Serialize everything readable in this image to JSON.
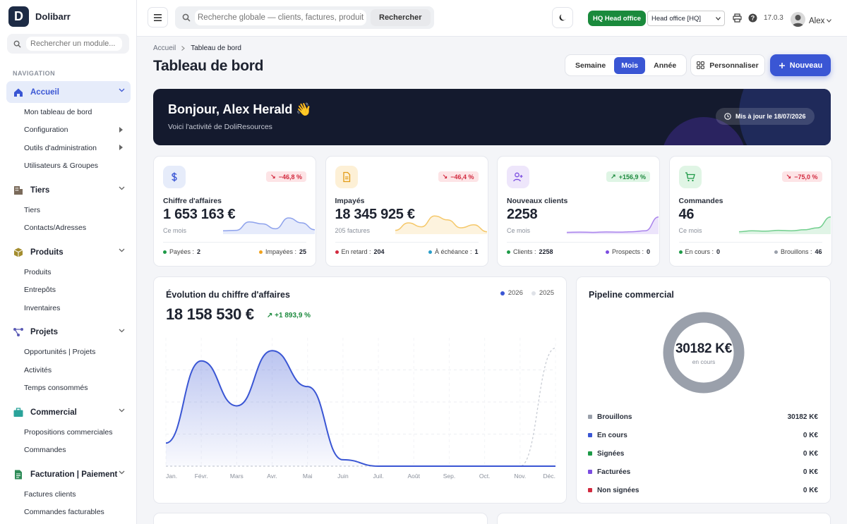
{
  "brand": {
    "logo_letter": "D",
    "name": "Dolibarr"
  },
  "sidebar": {
    "search_placeholder": "Rechercher un module...",
    "nav_label": "NAVIGATION",
    "sections": [
      {
        "label": "Accueil",
        "icon": "home-icon",
        "active": true,
        "items": [
          {
            "label": "Mon tableau de bord",
            "sub": false
          },
          {
            "label": "Configuration",
            "sub": true
          },
          {
            "label": "Outils d'administration",
            "sub": true
          },
          {
            "label": "Utilisateurs & Groupes",
            "sub": false
          }
        ]
      },
      {
        "label": "Tiers",
        "icon": "building-icon",
        "items": [
          {
            "label": "Tiers"
          },
          {
            "label": "Contacts/Adresses"
          }
        ]
      },
      {
        "label": "Produits",
        "icon": "box-icon",
        "items": [
          {
            "label": "Produits"
          },
          {
            "label": "Entrepôts"
          },
          {
            "label": "Inventaires"
          }
        ]
      },
      {
        "label": "Projets",
        "icon": "project-icon",
        "items": [
          {
            "label": "Opportunités | Projets"
          },
          {
            "label": "Activités"
          },
          {
            "label": "Temps consommés"
          }
        ]
      },
      {
        "label": "Commercial",
        "icon": "briefcase-icon",
        "items": [
          {
            "label": "Propositions commerciales"
          },
          {
            "label": "Commandes"
          }
        ]
      },
      {
        "label": "Facturation | Paiement",
        "icon": "invoice-icon",
        "items": [
          {
            "label": "Factures clients"
          },
          {
            "label": "Commandes facturables"
          }
        ]
      }
    ]
  },
  "topbar": {
    "search_placeholder": "Recherche globale — clients, factures, produits...",
    "search_button": "Rechercher",
    "hq_badge": "HQ Head office",
    "entity": "Head office [HQ]",
    "version": "17.0.3",
    "user": "Alex"
  },
  "page": {
    "breadcrumb": [
      "Accueil",
      "Tableau de bord"
    ],
    "title": "Tableau de bord",
    "periods": [
      "Semaine",
      "Mois",
      "Année"
    ],
    "active_period": "Mois",
    "customize": "Personnaliser",
    "new": "Nouveau"
  },
  "banner": {
    "greeting": "Bonjour, Alex Herald 👋",
    "subtitle": "Voici l'activité de DoliResources",
    "updated": "Mis à jour le 18/07/2026"
  },
  "kpis": [
    {
      "label": "Chiffre d'affaires",
      "value": "1 653 163 €",
      "sub": "Ce mois",
      "delta": "−46,8 %",
      "trend": "down",
      "icon": "dollar-icon",
      "icon_bg": "#e6ecfa",
      "icon_color": "#3a56d4",
      "spark_color": "#8ea2ec",
      "foot": [
        {
          "label": "Payées :",
          "value": "2",
          "color": "#1d9a47"
        },
        {
          "label": "Impayées :",
          "value": "25",
          "color": "#f0a21d"
        }
      ]
    },
    {
      "label": "Impayés",
      "value": "18 345 925 €",
      "sub": "205 factures",
      "delta": "−46,4 %",
      "trend": "down",
      "icon": "file-icon",
      "icon_bg": "#fdf0d6",
      "icon_color": "#e29a14",
      "spark_color": "#f5c86a",
      "foot": [
        {
          "label": "En retard :",
          "value": "204",
          "color": "#d22a3f"
        },
        {
          "label": "À échéance :",
          "value": "1",
          "color": "#2a9ec9"
        }
      ]
    },
    {
      "label": "Nouveaux clients",
      "value": "2258",
      "sub": "Ce mois",
      "delta": "+156,9 %",
      "trend": "up",
      "icon": "user-plus-icon",
      "icon_bg": "#eee6fb",
      "icon_color": "#7b4ce0",
      "spark_color": "#a983ec",
      "foot": [
        {
          "label": "Clients :",
          "value": "2258",
          "color": "#1d9a47"
        },
        {
          "label": "Prospects :",
          "value": "0",
          "color": "#7b4ce0"
        }
      ]
    },
    {
      "label": "Commandes",
      "value": "46",
      "sub": "Ce mois",
      "delta": "−75,0 %",
      "trend": "down",
      "icon": "cart-icon",
      "icon_bg": "#e0f5e5",
      "icon_color": "#1d9a47",
      "spark_color": "#72cf8e",
      "foot": [
        {
          "label": "En cours :",
          "value": "0",
          "color": "#1d9a47"
        },
        {
          "label": "Brouillons :",
          "value": "46",
          "color": "#9aa0ab"
        }
      ]
    }
  ],
  "revenue_chart": {
    "title": "Évolution du chiffre d'affaires",
    "total": "18 158 530 €",
    "delta": "+1 893,9 %",
    "legend": [
      {
        "label": "2026",
        "color": "#3a56d4"
      },
      {
        "label": "2025",
        "color": "#dfe2e8"
      }
    ]
  },
  "chart_data": {
    "type": "area",
    "categories": [
      "Jan.",
      "Févr.",
      "Mars",
      "Avr.",
      "Mai",
      "Juin",
      "Juil.",
      "Août",
      "Sep.",
      "Oct.",
      "Nov.",
      "Déc."
    ],
    "series": [
      {
        "name": "2026",
        "color": "#3a56d4",
        "values": [
          0.18,
          0.82,
          0.47,
          0.9,
          0.62,
          0.05,
          0.0,
          0.0,
          0.0,
          0.0,
          0.0,
          0.0
        ]
      },
      {
        "name": "2025",
        "color": "#c8ccd4",
        "dashed": true,
        "values": [
          0.0,
          0.0,
          0.0,
          0.0,
          0.0,
          0.0,
          0.0,
          0.0,
          0.0,
          0.0,
          0.0,
          0.92
        ]
      }
    ],
    "grid": true
  },
  "pipeline": {
    "title": "Pipeline commercial",
    "total": "30182 K€",
    "total_label": "en cours",
    "rows": [
      {
        "label": "Brouillons",
        "value": "30182 K€",
        "color": "#9aa0ab"
      },
      {
        "label": "En cours",
        "value": "0 K€",
        "color": "#3a56d4"
      },
      {
        "label": "Signées",
        "value": "0 K€",
        "color": "#1d9a47"
      },
      {
        "label": "Facturées",
        "value": "0 K€",
        "color": "#7b4ce0"
      },
      {
        "label": "Non signées",
        "value": "0 K€",
        "color": "#d22a3f"
      }
    ]
  }
}
